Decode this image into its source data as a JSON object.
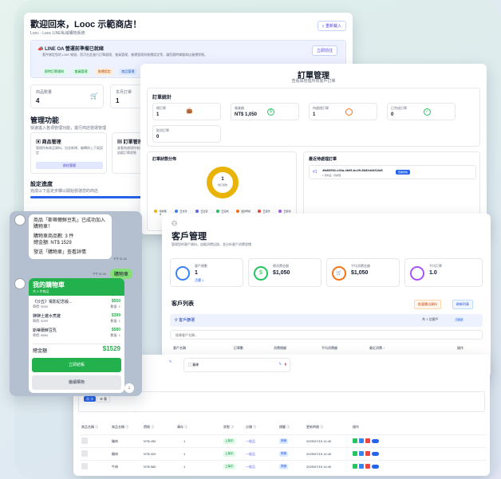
{
  "dashboard": {
    "title": "歡迎回來，Looc 示範商店！",
    "subtitle": "Looc - Looc LINE私域購物系統",
    "button": "重新載入",
    "notice_title": "LINE OA 營運前準備已就緒",
    "notice_text": "套件綁定您的 LINE 帳號，您可在此進行訂單處理、會員管理、營運管理與推播設定等，讓您隨時掌握商店營運狀態。",
    "notice_button": "立即前往",
    "notice_tags": [
      "即時訂單通知",
      "會員管理",
      "推播設定",
      "商品管理"
    ],
    "stats": [
      {
        "label": "商品數量",
        "value": "4"
      },
      {
        "label": "本月訂單",
        "value": "1"
      }
    ],
    "section_title": "管理功能",
    "section_sub": "快速進入各項管理功能，進行商店營運管理",
    "features": [
      {
        "title": "商品管理",
        "desc": "管理所有商品資料，包含新增、編輯與上下架設定",
        "button": "前往管理"
      },
      {
        "title": "訂單管理",
        "desc": "查看和處理所有訂單，追蹤訂單狀態"
      }
    ],
    "progress_title": "設定進度",
    "progress_sub": "完成以下設定步驟以開始營運您的商店"
  },
  "orders": {
    "title": "訂單管理",
    "subtitle": "查看與管理所有客戶訂單",
    "stats_title": "訂單統計",
    "stats": [
      {
        "label": "總訂單",
        "value": "1"
      },
      {
        "label": "營業額",
        "value": "NT$ 1,050"
      },
      {
        "label": "待處理訂單",
        "value": "1"
      },
      {
        "label": "已完成訂單",
        "value": "0"
      },
      {
        "label": "取消訂單",
        "value": "0"
      }
    ],
    "dist_title": "訂單狀態分佈",
    "donut_value": "1",
    "donut_label": "總訂單數",
    "legend": [
      {
        "label": "待處理",
        "value": "1",
        "color": "#eab308"
      },
      {
        "label": "已付款",
        "value": "0",
        "color": "#3b82f6"
      },
      {
        "label": "已出貨",
        "value": "0",
        "color": "#6366f1"
      },
      {
        "label": "已完成",
        "value": "0",
        "color": "#22c55e"
      },
      {
        "label": "退款申請",
        "value": "0",
        "color": "#f97316"
      },
      {
        "label": "已退款",
        "value": "0",
        "color": "#ef4444"
      },
      {
        "label": "已取消",
        "value": "0",
        "color": "#a855f7"
      }
    ],
    "recent_title": "最近待處理訂單",
    "recent_id": "4fa60932-c02a-4b96-bc29-8b52d44f12a5",
    "recent_sub": "1 項商品 · 待處理",
    "recent_button": "查看詳情"
  },
  "customers": {
    "title": "客戶管理",
    "subtitle": "管理您的客戶資料，追蹤消費記錄，並分析客戶消費習慣",
    "stats": [
      {
        "label": "客戶總數",
        "value": "1",
        "sub": "活躍 1",
        "color": "#3b82f6"
      },
      {
        "label": "總消費金額",
        "value": "$1,050",
        "color": "#22c55e"
      },
      {
        "label": "平均消費金額",
        "value": "$1,050",
        "color": "#f97316"
      },
      {
        "label": "平均訂單",
        "value": "1.0",
        "color": "#a855f7"
      }
    ],
    "list_title": "客戶列表",
    "btn_export": "批量匯出資料",
    "btn_refresh": "刷新列表",
    "filter_title": "客戶篩選",
    "filter_count": "共 1 位客戶",
    "filter_badge": "已篩選",
    "search_placeholder": "搜尋客戶名稱...",
    "columns": [
      "客戶名稱",
      "訂單數",
      "消費總額",
      "平均消費額",
      "最近消費 ↓",
      "操作"
    ]
  },
  "table": {
    "columns": [
      "商品名稱 ⓘ",
      "商品名稱 ⓘ",
      "價格 ⓘ",
      "庫存 ⓘ",
      "狀態 ⓘ",
      "分類 ⓘ",
      "標籤 ⓘ",
      "更新時間 ⓘ",
      "操作"
    ],
    "rows": [
      {
        "name": "豬肉",
        "price": "NT$ 450",
        "stock": "1",
        "status": "上架中",
        "cat": "一般品",
        "tag": "熱銷",
        "time": "2025/07/15 14:40"
      },
      {
        "name": "雞肉",
        "price": "NT$ 320",
        "stock": "1",
        "status": "上架中",
        "cat": "一般品",
        "tag": "熱銷",
        "time": "2025/07/15 14:40"
      },
      {
        "name": "牛肉",
        "price": "NT$ 580",
        "stock": "1",
        "status": "上架中",
        "cat": "一般品",
        "tag": "熱銷",
        "time": "2025/07/15 14:40"
      }
    ],
    "top_item": "蘋果"
  },
  "chat": {
    "msg1": "商品「斯蒂爾鮮豆乳」已成功加入購物車！",
    "msg1b": "購物車商品數: 3 件",
    "msg1c": "總金額: NT$ 1529",
    "msg1d": "發送「購物車」查看詳情",
    "time1": "下午 01:34",
    "user_msg": "購物車",
    "time2": "下午 01:34",
    "cart_title": "我的購物車",
    "cart_sub": "共 3 件商品",
    "items": [
      {
        "name": "《沙丘》電影紀念版...",
        "price": "$550",
        "unit": "單價: $550",
        "qty": "數量: 1"
      },
      {
        "name": "驊驊土雞水煮雞",
        "price": "$399",
        "unit": "單價: $399",
        "qty": "數量: 1"
      },
      {
        "name": "斯蒂爾鮮豆乳",
        "price": "$580",
        "unit": "單價: $580",
        "qty": "數量: 1"
      }
    ],
    "total_label": "總金額",
    "total_value": "$1529",
    "checkout": "立即結帳",
    "continue": "繼續購物"
  }
}
